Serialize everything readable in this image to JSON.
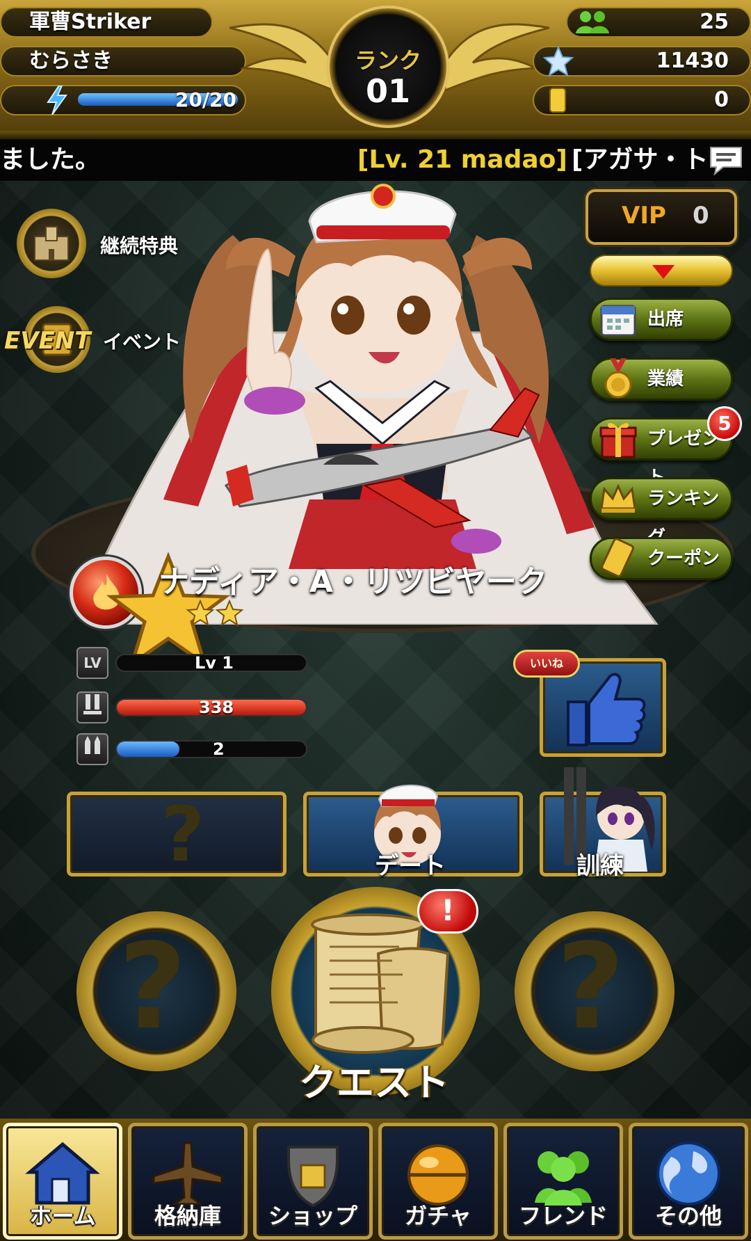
{
  "header": {
    "title": "軍曹Striker",
    "player_name": "むらさき",
    "energy": "20/20",
    "energy_fraction": 1.0,
    "rank_label": "ランク",
    "rank_value": "01",
    "friends": "25",
    "stones": "11430",
    "tickets": "0"
  },
  "ticker": {
    "text_left": "ました。",
    "text_highlight": "[Lv. 21 madao]",
    "text_right": "[アガサ・ト"
  },
  "shortcuts": {
    "bonus_label": "継続特典",
    "event_label": "イベント",
    "event_badge": "EVENT"
  },
  "right_menu": {
    "vip_label": "VIP",
    "vip_value": "0",
    "items": [
      {
        "label": "出席",
        "icon": "calendar-icon"
      },
      {
        "label": "業績",
        "icon": "medal-icon"
      },
      {
        "label": "プレゼント",
        "icon": "gift-icon"
      },
      {
        "label": "ランキング",
        "icon": "crown-icon"
      },
      {
        "label": "クーポン",
        "icon": "coupon-icon"
      }
    ],
    "present_badge": "5"
  },
  "unit": {
    "name": "ナディア・A・リツビヤーク",
    "stars": 2,
    "level_icon": "LV",
    "level": "Lv 1",
    "level_fraction": 0.0,
    "hp": "338",
    "hp_fraction": 1.0,
    "mp": "2",
    "mp_fraction": 0.33
  },
  "actions": {
    "like_badge": "いいね",
    "date_label": "デート",
    "train_label": "訓練",
    "quest_label": "クエスト",
    "quest_alert": "!",
    "unknown_mark": "?"
  },
  "bottom_nav": [
    {
      "label": "ホーム",
      "icon": "home-icon",
      "active": true
    },
    {
      "label": "格納庫",
      "icon": "plane-icon",
      "active": false
    },
    {
      "label": "ショップ",
      "icon": "shop-icon",
      "active": false
    },
    {
      "label": "ガチャ",
      "icon": "gacha-icon",
      "active": false
    },
    {
      "label": "フレンド",
      "icon": "friends-icon",
      "active": false
    },
    {
      "label": "その他",
      "icon": "globe-icon",
      "active": false
    }
  ],
  "colors": {
    "gold": "#c9a33a",
    "hp_red": "#d42a1a",
    "mp_blue": "#2a7ad8",
    "ticker_highlight": "#f0d030",
    "vip_orange": "#f0a828"
  }
}
